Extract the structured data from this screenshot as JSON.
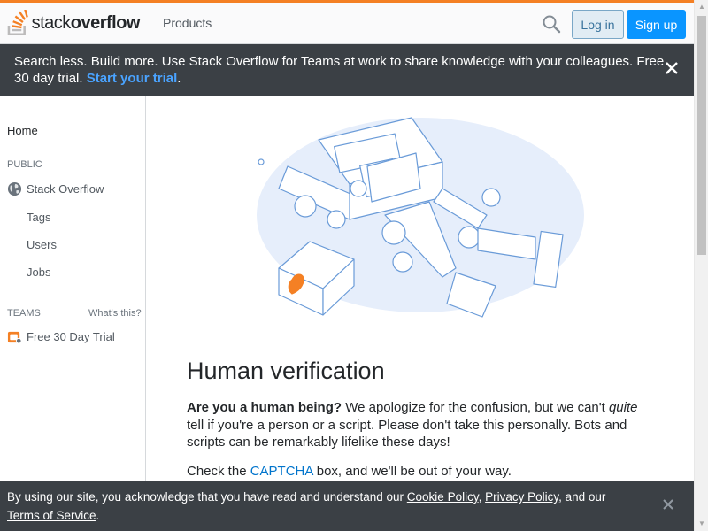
{
  "header": {
    "logo_text_light": "stack",
    "logo_text_bold": "overflow",
    "nav_products": "Products",
    "login_label": "Log in",
    "signup_label": "Sign up"
  },
  "banner": {
    "text": "Search less. Build more. Use Stack Overflow for Teams at work to share knowledge with your colleagues. Free 30 day trial. ",
    "link": "Start your trial",
    "suffix": "."
  },
  "sidebar": {
    "home": "Home",
    "public_label": "PUBLIC",
    "stack_overflow": "Stack Overflow",
    "tags": "Tags",
    "users": "Users",
    "jobs": "Jobs",
    "teams_label": "TEAMS",
    "whats_this": "What's this?",
    "free_trial": "Free 30 Day Trial"
  },
  "main": {
    "title": "Human verification",
    "p1_bold": "Are you a human being?",
    "p1_a": " We apologize for the confusion, but we can't ",
    "p1_italic": "quite",
    "p1_b": " tell if you're a person or a script. Please don't take this personally. Bots and scripts can be remarkably lifelike these days!",
    "p2_a": "Check the ",
    "p2_link": "CAPTCHA",
    "p2_b": " box, and we'll be out of your way."
  },
  "cookie": {
    "text_a": "By using our site, you acknowledge that you have read and understand our ",
    "cookie_policy": "Cookie Policy",
    "comma": ", ",
    "privacy_policy": "Privacy Policy",
    "and_our": ", and our ",
    "terms": "Terms of Service",
    "period": "."
  },
  "colors": {
    "brand_orange": "#f48024",
    "primary_blue": "#0a95ff",
    "banner_bg": "#3b4045"
  }
}
